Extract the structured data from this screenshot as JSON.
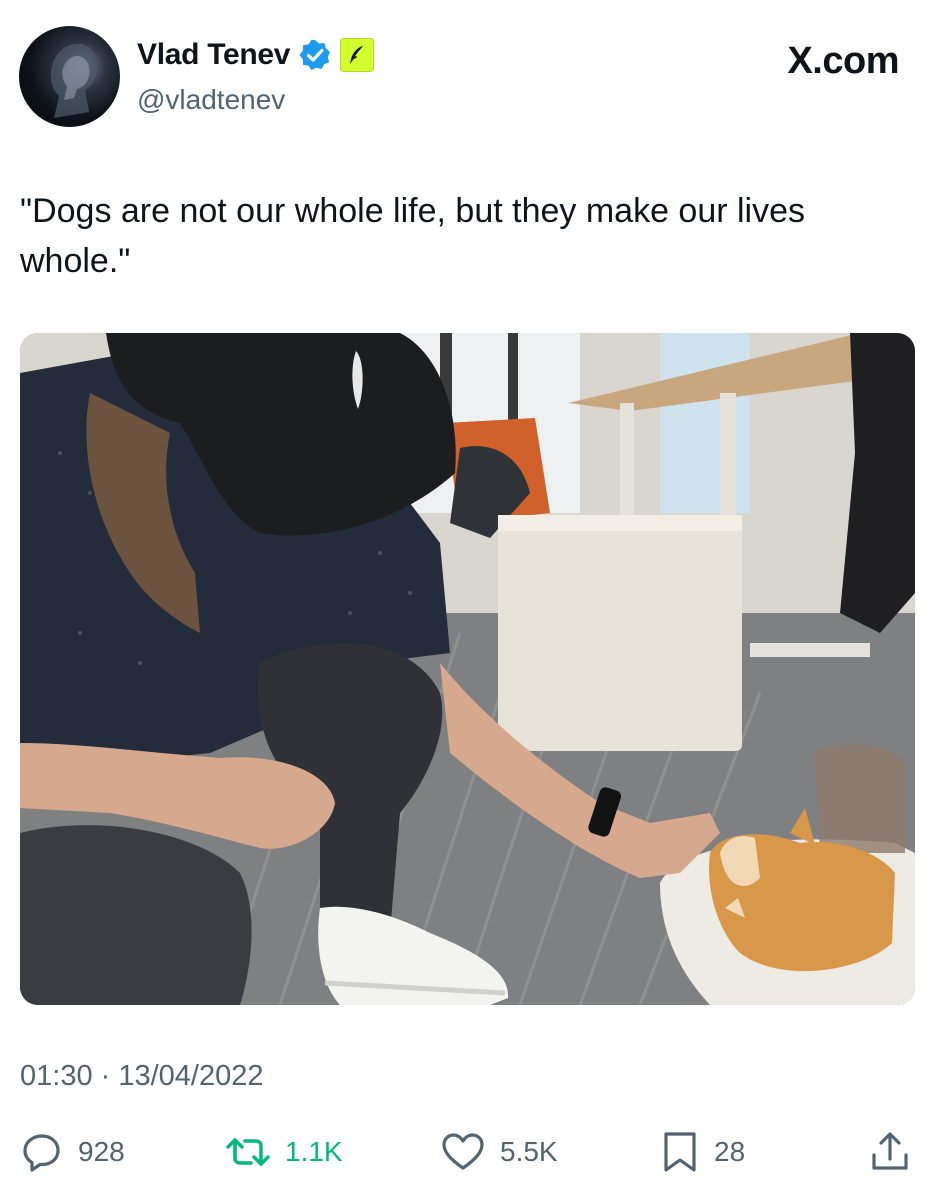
{
  "author": {
    "display_name": "Vlad Tenev",
    "handle": "@vladtenev",
    "verified_badge": "verified-check-icon",
    "affiliation_badge": "robinhood-feather-icon"
  },
  "site": {
    "label": "X.com"
  },
  "tweet": {
    "text": "\"Dogs are not our whole life, but they make our lives whole.\"",
    "media_icon": "photo",
    "timestamp": "01:30 · 13/04/2022"
  },
  "actions": {
    "replies": {
      "icon": "reply-icon",
      "count": "928"
    },
    "retweets": {
      "icon": "retweet-icon",
      "count": "1.1K"
    },
    "likes": {
      "icon": "heart-icon",
      "count": "5.5K"
    },
    "bookmarks": {
      "icon": "bookmark-icon",
      "count": "28"
    },
    "share": {
      "icon": "share-icon"
    }
  },
  "colors": {
    "verified_blue": "#1d9bf0",
    "affiliate_green": "#d2ff2e",
    "retweet_green": "#00ba7c",
    "secondary_text": "#536471",
    "primary_text": "#0f1419"
  }
}
